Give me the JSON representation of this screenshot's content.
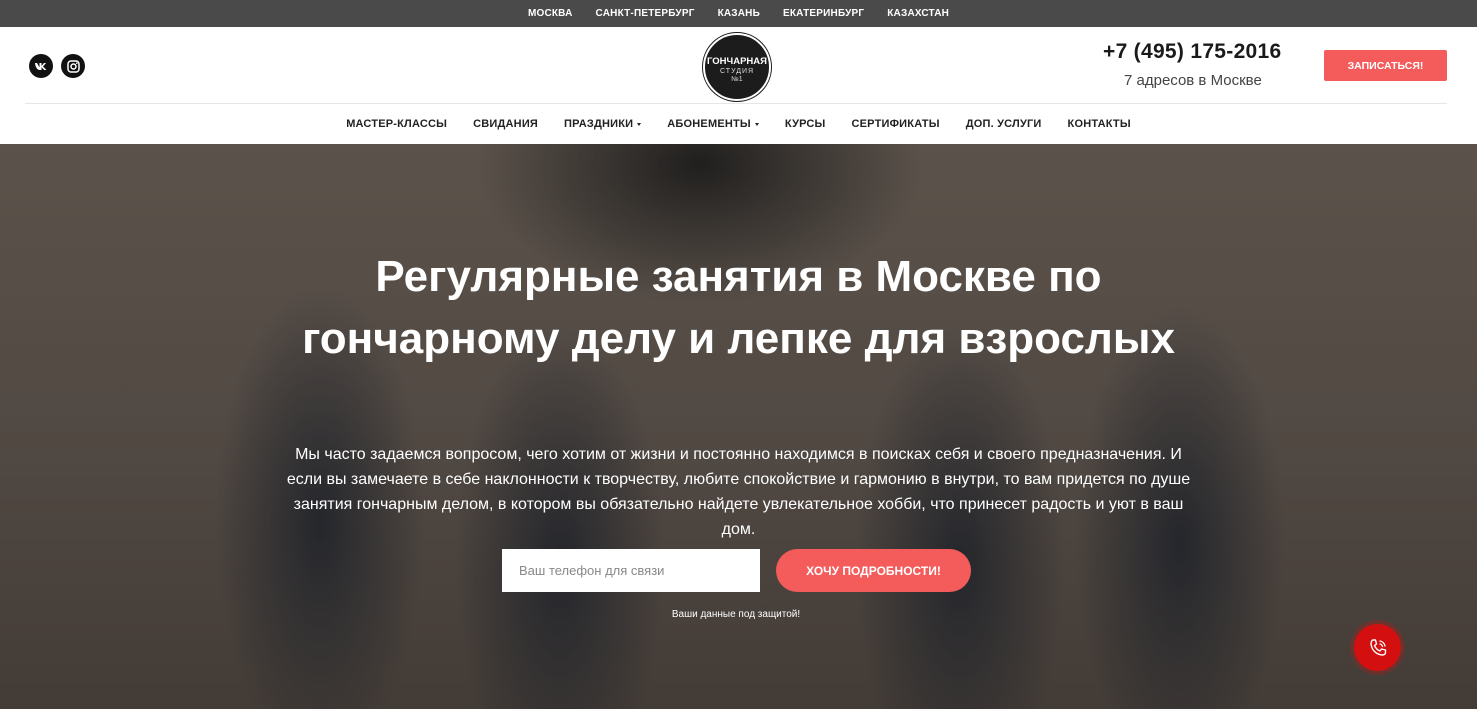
{
  "city_bar": {
    "cities": [
      "МОСКВА",
      "САНКТ-ПЕТЕРБУРГ",
      "КАЗАНЬ",
      "ЕКАТЕРИНБУРГ",
      "КАЗАХСТАН"
    ]
  },
  "header": {
    "socials": [
      {
        "name": "vk-icon",
        "label": "VK"
      },
      {
        "name": "instagram-icon",
        "label": "Instagram"
      }
    ],
    "logo": {
      "line1": "ГОНЧАРНАЯ",
      "line2": "СТУДИЯ",
      "line3": "№1"
    },
    "phone": "+7 (495) 175-2016",
    "addresses": "7 адресов в Москве",
    "signup_label": "ЗАПИСАТЬСЯ!"
  },
  "nav": {
    "items": [
      {
        "label": "МАСТЕР-КЛАССЫ",
        "dropdown": false
      },
      {
        "label": "СВИДАНИЯ",
        "dropdown": false
      },
      {
        "label": "ПРАЗДНИКИ",
        "dropdown": true
      },
      {
        "label": "АБОНЕМЕНТЫ",
        "dropdown": true
      },
      {
        "label": "КУРСЫ",
        "dropdown": false
      },
      {
        "label": "СЕРТИФИКАТЫ",
        "dropdown": false
      },
      {
        "label": "ДОП. УСЛУГИ",
        "dropdown": false
      },
      {
        "label": "КОНТАКТЫ",
        "dropdown": false
      }
    ]
  },
  "hero": {
    "title": "Регулярные занятия в Москве по гончарному делу и лепке для взрослых",
    "text": "Мы часто задаемся вопросом, чего хотим от жизни и постоянно находимся в поисках себя и своего предназначения. И если вы замечаете в себе наклонности к творчеству, любите спокойствие и гармонию в внутри, то вам придется по душе занятия гончарным делом, в котором вы обязательно найдете увлекательное хобби, что принесет радость и уют в ваш дом.",
    "phone_placeholder": "Ваш телефон для связи",
    "phone_value": "",
    "cta_label": "ХОЧУ ПОДРОБНОСТИ!",
    "privacy": "Ваши данные под защитой!"
  },
  "colors": {
    "accent": "#f45b5b",
    "call_button": "#d40f10",
    "city_bar": "#4a4a4a"
  }
}
